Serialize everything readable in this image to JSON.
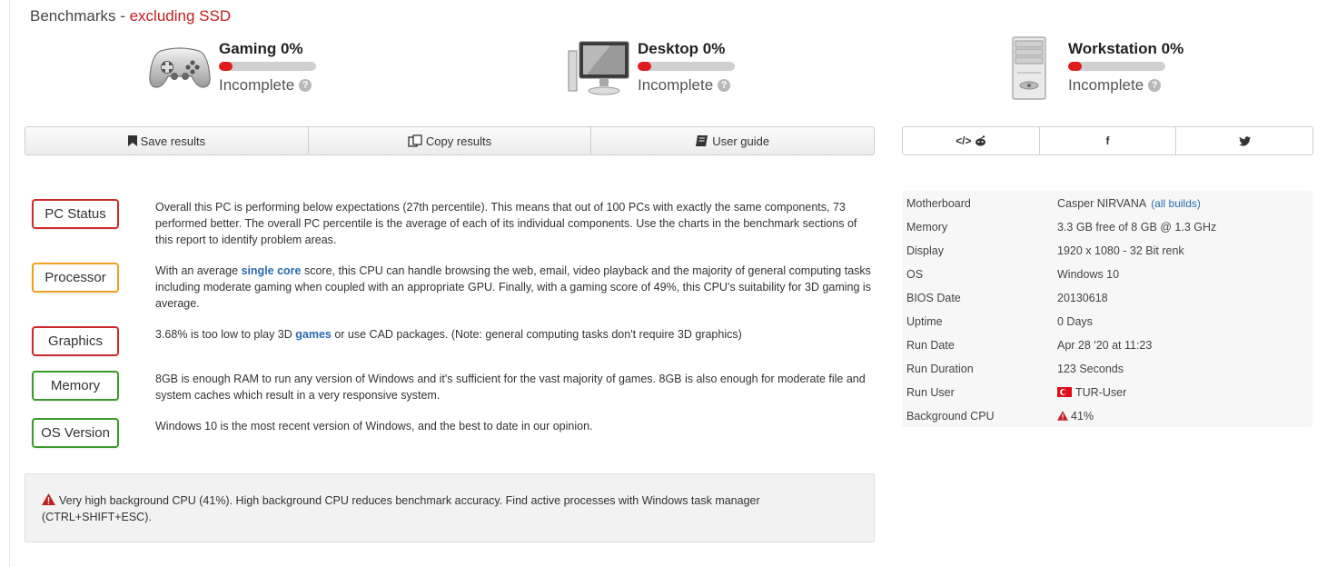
{
  "header": {
    "title": "Benchmarks",
    "separator": " - ",
    "subtitle": "excluding SSD"
  },
  "benchmarks": [
    {
      "icon": "gamepad-icon",
      "title": "Gaming 0%",
      "progress": 0.0,
      "status": "Incomplete"
    },
    {
      "icon": "desktop-monitor-icon",
      "title": "Desktop 0%",
      "progress": 0.0,
      "status": "Incomplete"
    },
    {
      "icon": "workstation-tower-icon",
      "title": "Workstation 0%",
      "progress": 0.0,
      "status": "Incomplete"
    }
  ],
  "toolbar": {
    "save": {
      "icon": "bookmark-icon",
      "label": "Save results"
    },
    "copy": {
      "icon": "copy-icon",
      "label": "Copy results"
    },
    "guide": {
      "icon": "book-icon",
      "label": "User guide"
    }
  },
  "share": {
    "embed_reddit": {
      "icon": "embed-reddit-icon",
      "label": "</> ☻"
    },
    "facebook": {
      "icon": "facebook-icon",
      "label": "f"
    },
    "twitter": {
      "icon": "twitter-icon",
      "label": "🐦"
    }
  },
  "status_items": [
    {
      "label": "PC Status",
      "color": "#cc2b2b",
      "text": "Overall this PC is performing below expectations (27th percentile). This means that out of 100 PCs with exactly the same components, 73 performed better. The overall PC percentile is the average of each of its individual components. Use the charts in the benchmark sections of this report to identify problem areas."
    },
    {
      "label": "Processor",
      "color": "#f0a020",
      "text_before": "With an average ",
      "link": "single core",
      "text_after": " score, this CPU can handle browsing the web, email, video playback and the majority of general computing tasks including moderate gaming when coupled with an appropriate GPU. Finally, with a gaming score of 49%, this CPU's suitability for 3D gaming is average."
    },
    {
      "label": "Graphics",
      "color": "#cc2b2b",
      "text_before": "3.68% is too low to play 3D ",
      "link": "games",
      "text_after": " or use CAD packages. (Note: general computing tasks don't require 3D graphics)"
    },
    {
      "label": "Memory",
      "color": "#3c9a2a",
      "text": "8GB is enough RAM to run any version of Windows and it's sufficient for the vast majority of games. 8GB is also enough for moderate file and system caches which result in a very responsive system."
    },
    {
      "label": "OS Version",
      "color": "#3c9a2a",
      "text": "Windows 10 is the most recent version of Windows, and the best to date in our opinion."
    }
  ],
  "warning": {
    "icon": "warning-triangle-icon",
    "text": "Very high background CPU (41%). High background CPU reduces benchmark accuracy. Find active processes with Windows task manager (CTRL+SHIFT+ESC)."
  },
  "system_info": [
    {
      "key": "Motherboard",
      "value": "Casper NIRVANA",
      "link": "(all builds)"
    },
    {
      "key": "Memory",
      "value": "3.3 GB free of 8 GB @ 1.3 GHz"
    },
    {
      "key": "Display",
      "value": "1920 x 1080 - 32 Bit renk"
    },
    {
      "key": "OS",
      "value": "Windows 10"
    },
    {
      "key": "BIOS Date",
      "value": "20130618"
    },
    {
      "key": "Uptime",
      "value": "0 Days"
    },
    {
      "key": "Run Date",
      "value": "Apr 28 '20 at 11:23"
    },
    {
      "key": "Run Duration",
      "value": "123 Seconds"
    },
    {
      "key": "Run User",
      "value": "TUR-User",
      "icon": "turkey-flag-icon"
    },
    {
      "key": "Background CPU",
      "value": "41%",
      "icon": "warning-triangle-icon"
    }
  ]
}
